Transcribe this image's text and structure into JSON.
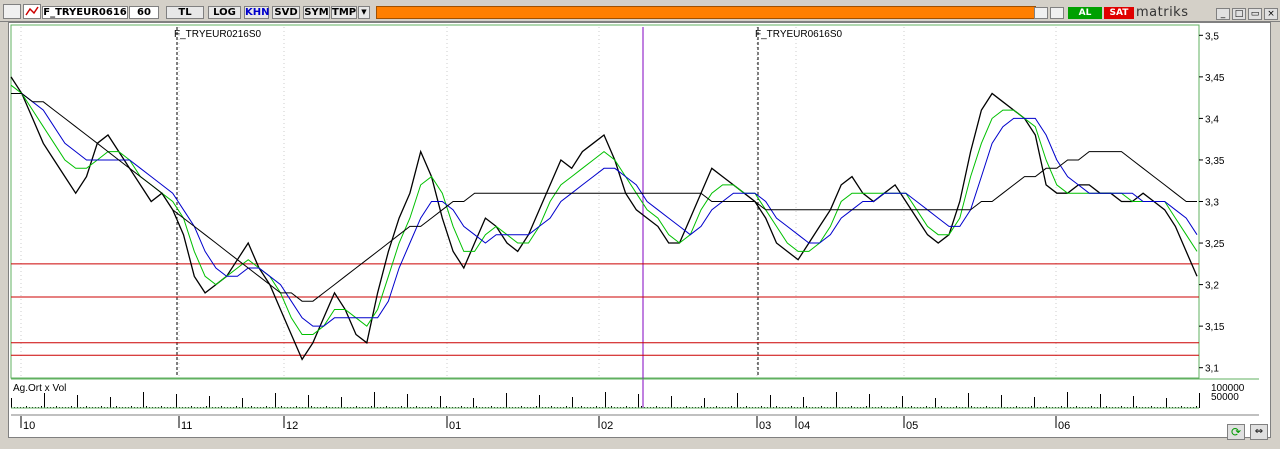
{
  "toolbar": {
    "symbol": "F_TRYEUR0616",
    "period": "60",
    "currency": "TL",
    "log": "LOG",
    "khn": "KHN",
    "svd": "SVD",
    "sym": "SYM",
    "tmp": "TMP",
    "buy_label": "AL",
    "sell_label": "SAT",
    "brand": "matriks"
  },
  "colors": {
    "toolbar_bg": "#d4d0c8",
    "orange_bar": "#ff7f00",
    "buy": "#00a000",
    "sell": "#e00000",
    "price": "#000000",
    "ma_fast": "#00c000",
    "ma_mid": "#0000cc",
    "ma_slow": "#000000",
    "hline": "#cc0000",
    "contract_roll": "#8000c0"
  },
  "chart_data": {
    "type": "line",
    "contract_labels": [
      "F_TRYEUR0216S0",
      "F_TRYEUR0616S0"
    ],
    "y_ticks": [
      "3,5",
      "3,45",
      "3,4",
      "3,35",
      "3,3",
      "3,25",
      "3,2",
      "3,15",
      "3,1"
    ],
    "ylim": [
      3.09,
      3.51
    ],
    "x_ticks": [
      "10",
      "11",
      "12",
      "01",
      "02",
      "03",
      "04",
      "05",
      "06"
    ],
    "horizontal_levels": [
      3.225,
      3.185,
      3.13,
      3.115
    ],
    "volume_panel_label": "Ag.Ort x Vol",
    "volume_ticks": [
      "100000",
      "50000"
    ],
    "series": [
      {
        "values": [
          3.45,
          3.43,
          3.4,
          3.37,
          3.35,
          3.33,
          3.31,
          3.33,
          3.37,
          3.38,
          3.36,
          3.34,
          3.32,
          3.3,
          3.31,
          3.29,
          3.26,
          3.21,
          3.19,
          3.2,
          3.21,
          3.23,
          3.25,
          3.22,
          3.2,
          3.17,
          3.14,
          3.11,
          3.13,
          3.16,
          3.19,
          3.17,
          3.14,
          3.13,
          3.19,
          3.24,
          3.28,
          3.31,
          3.36,
          3.33,
          3.28,
          3.24,
          3.22,
          3.25,
          3.28,
          3.27,
          3.25,
          3.24,
          3.26,
          3.29,
          3.32,
          3.35,
          3.34,
          3.36,
          3.37,
          3.38,
          3.35,
          3.31,
          3.29,
          3.28,
          3.27,
          3.25,
          3.25,
          3.28,
          3.31,
          3.34,
          3.33,
          3.32,
          3.31,
          3.3,
          3.28,
          3.25,
          3.24,
          3.23,
          3.25,
          3.27,
          3.29,
          3.32,
          3.33,
          3.31,
          3.3,
          3.31,
          3.32,
          3.3,
          3.28,
          3.26,
          3.25,
          3.26,
          3.3,
          3.36,
          3.41,
          3.43,
          3.42,
          3.41,
          3.4,
          3.38,
          3.32,
          3.31,
          3.31,
          3.32,
          3.32,
          3.31,
          3.31,
          3.3,
          3.3,
          3.31,
          3.3,
          3.29,
          3.27,
          3.24,
          3.21
        ]
      },
      {
        "values": [
          3.44,
          3.43,
          3.41,
          3.39,
          3.37,
          3.35,
          3.34,
          3.34,
          3.35,
          3.36,
          3.36,
          3.35,
          3.33,
          3.32,
          3.31,
          3.3,
          3.28,
          3.24,
          3.21,
          3.2,
          3.21,
          3.22,
          3.23,
          3.22,
          3.21,
          3.19,
          3.16,
          3.14,
          3.14,
          3.15,
          3.17,
          3.17,
          3.16,
          3.15,
          3.17,
          3.21,
          3.25,
          3.28,
          3.32,
          3.33,
          3.31,
          3.27,
          3.24,
          3.24,
          3.26,
          3.27,
          3.26,
          3.25,
          3.25,
          3.27,
          3.3,
          3.32,
          3.33,
          3.34,
          3.35,
          3.36,
          3.35,
          3.33,
          3.31,
          3.29,
          3.28,
          3.26,
          3.25,
          3.26,
          3.29,
          3.31,
          3.32,
          3.32,
          3.31,
          3.31,
          3.29,
          3.27,
          3.25,
          3.24,
          3.24,
          3.25,
          3.27,
          3.3,
          3.31,
          3.31,
          3.31,
          3.31,
          3.31,
          3.31,
          3.29,
          3.27,
          3.26,
          3.26,
          3.28,
          3.33,
          3.37,
          3.4,
          3.41,
          3.41,
          3.4,
          3.39,
          3.35,
          3.32,
          3.31,
          3.31,
          3.31,
          3.31,
          3.31,
          3.31,
          3.3,
          3.3,
          3.3,
          3.3,
          3.28,
          3.26,
          3.24
        ]
      },
      {
        "values": [
          3.43,
          3.43,
          3.42,
          3.41,
          3.39,
          3.37,
          3.36,
          3.35,
          3.35,
          3.35,
          3.35,
          3.35,
          3.34,
          3.33,
          3.32,
          3.31,
          3.29,
          3.27,
          3.24,
          3.22,
          3.21,
          3.21,
          3.22,
          3.22,
          3.21,
          3.2,
          3.18,
          3.16,
          3.15,
          3.15,
          3.16,
          3.16,
          3.16,
          3.16,
          3.16,
          3.18,
          3.22,
          3.25,
          3.28,
          3.3,
          3.3,
          3.29,
          3.27,
          3.26,
          3.25,
          3.26,
          3.26,
          3.26,
          3.26,
          3.27,
          3.28,
          3.3,
          3.31,
          3.32,
          3.33,
          3.34,
          3.34,
          3.33,
          3.32,
          3.3,
          3.29,
          3.28,
          3.27,
          3.26,
          3.27,
          3.29,
          3.3,
          3.31,
          3.31,
          3.31,
          3.3,
          3.28,
          3.27,
          3.26,
          3.25,
          3.25,
          3.26,
          3.28,
          3.29,
          3.3,
          3.3,
          3.31,
          3.31,
          3.31,
          3.3,
          3.29,
          3.28,
          3.27,
          3.27,
          3.29,
          3.33,
          3.37,
          3.39,
          3.4,
          3.4,
          3.4,
          3.38,
          3.35,
          3.33,
          3.32,
          3.31,
          3.31,
          3.31,
          3.31,
          3.31,
          3.3,
          3.3,
          3.3,
          3.29,
          3.28,
          3.26
        ]
      },
      {
        "values": [
          3.43,
          3.43,
          3.42,
          3.42,
          3.41,
          3.4,
          3.39,
          3.38,
          3.37,
          3.36,
          3.35,
          3.34,
          3.33,
          3.32,
          3.31,
          3.29,
          3.28,
          3.27,
          3.26,
          3.25,
          3.24,
          3.23,
          3.22,
          3.21,
          3.2,
          3.19,
          3.19,
          3.18,
          3.18,
          3.19,
          3.2,
          3.21,
          3.22,
          3.23,
          3.24,
          3.25,
          3.26,
          3.27,
          3.27,
          3.28,
          3.29,
          3.3,
          3.3,
          3.31,
          3.31,
          3.31,
          3.31,
          3.31,
          3.31,
          3.31,
          3.31,
          3.31,
          3.31,
          3.31,
          3.31,
          3.31,
          3.31,
          3.31,
          3.31,
          3.31,
          3.31,
          3.31,
          3.31,
          3.31,
          3.31,
          3.3,
          3.3,
          3.3,
          3.3,
          3.3,
          3.29,
          3.29,
          3.29,
          3.29,
          3.29,
          3.29,
          3.29,
          3.29,
          3.29,
          3.29,
          3.29,
          3.29,
          3.29,
          3.29,
          3.29,
          3.29,
          3.29,
          3.29,
          3.29,
          3.29,
          3.3,
          3.3,
          3.31,
          3.32,
          3.33,
          3.33,
          3.34,
          3.34,
          3.35,
          3.35,
          3.36,
          3.36,
          3.36,
          3.36,
          3.35,
          3.34,
          3.33,
          3.32,
          3.31,
          3.3,
          3.3
        ]
      }
    ],
    "grid": true
  }
}
